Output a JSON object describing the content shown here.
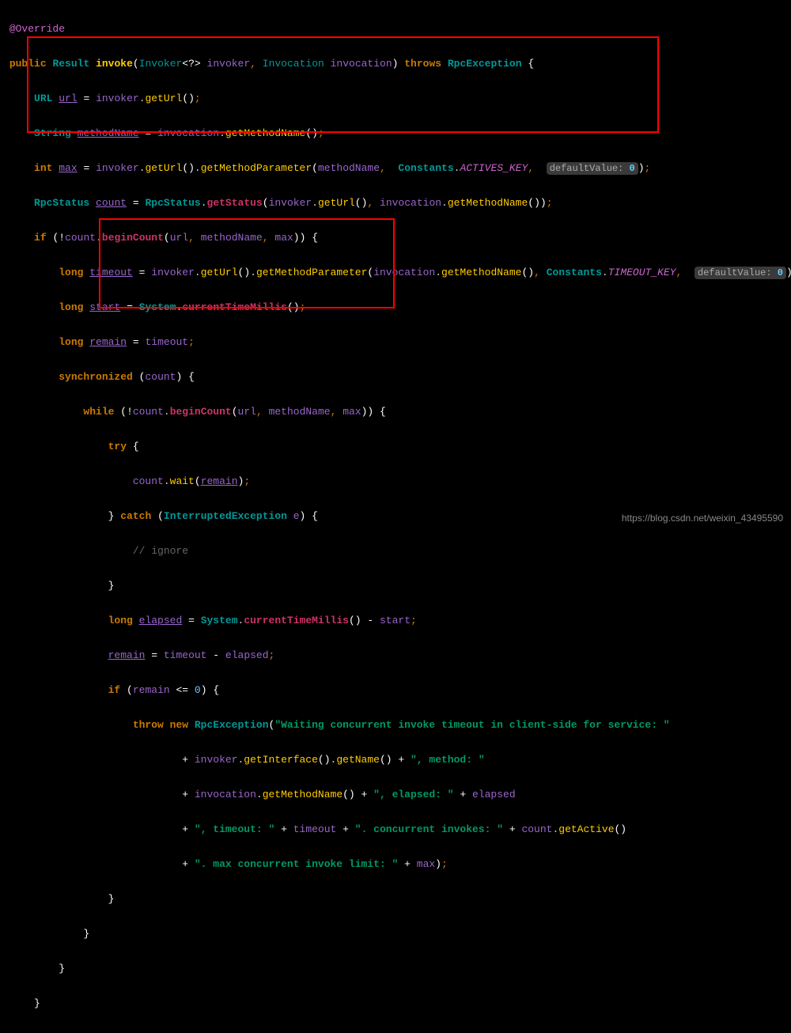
{
  "line01": {
    "ann": "@Override"
  },
  "line02": {
    "kw1": "public",
    "type": "Result",
    "mname": "invoke",
    "pt1": "Invoker",
    "q": "?",
    "pn1": "invoker",
    "pt2": "Invocation",
    "pn2": "invocation",
    "throws": "throws",
    "exc": "RpcException"
  },
  "line03": {
    "type": "URL",
    "var": "url",
    "op": "=",
    "r": "invoker",
    "dot": ".",
    "m": "getUrl"
  },
  "line04": {
    "type": "String",
    "var": "methodName",
    "op": "=",
    "r": "invocation",
    "m": "getMethodName"
  },
  "line05": {
    "type": "int",
    "var": "max",
    "op": "=",
    "r": "invoker",
    "m1": "getUrl",
    "m2": "getMethodParameter",
    "a1": "methodName",
    "cls": "Constants",
    "fld": "ACTIVES_KEY",
    "hint": "defaultValue:",
    "hv": "0"
  },
  "line06": {
    "type": "RpcStatus",
    "var": "count",
    "op": "=",
    "cls": "RpcStatus",
    "m": "getStatus",
    "r": "invoker",
    "m1": "getUrl",
    "r2": "invocation",
    "m2": "getMethodName"
  },
  "line07": {
    "kw": "if",
    "r": "count",
    "m": "beginCount",
    "a1": "url",
    "a2": "methodName",
    "a3": "max"
  },
  "line08": {
    "type": "long",
    "var": "timeout",
    "op": "=",
    "r": "invoker",
    "m1": "getUrl",
    "m2": "getMethodParameter",
    "r2": "invocation",
    "m3": "getMethodName",
    "cls": "Constants",
    "fld": "TIMEOUT_KEY",
    "hint": "defaultValue:",
    "hv": "0"
  },
  "line09": {
    "type": "long",
    "var": "start",
    "op": "=",
    "cls": "System",
    "m": "currentTimeMillis"
  },
  "line10": {
    "type": "long",
    "var": "remain",
    "op": "=",
    "r": "timeout"
  },
  "line11": {
    "kw": "synchronized",
    "a": "count"
  },
  "line12": {
    "kw": "while",
    "r": "count",
    "m": "beginCount",
    "a1": "url",
    "a2": "methodName",
    "a3": "max"
  },
  "line13": {
    "kw": "try"
  },
  "line14": {
    "r": "count",
    "m": "wait",
    "a": "remain"
  },
  "line15": {
    "kw": "catch",
    "type": "InterruptedException",
    "var": "e"
  },
  "line16": {
    "c": "// ignore"
  },
  "line18": {
    "type": "long",
    "var": "elapsed",
    "op": "=",
    "cls": "System",
    "m": "currentTimeMillis",
    "op2": "-",
    "r": "start"
  },
  "line19": {
    "var": "remain",
    "op": "=",
    "r1": "timeout",
    "op2": "-",
    "r2": "elapsed"
  },
  "line20": {
    "kw": "if",
    "var": "remain",
    "op": "<=",
    "n": "0"
  },
  "line21": {
    "kw1": "throw",
    "kw2": "new",
    "type": "RpcException",
    "s": "\"Waiting concurrent invoke timeout in client-side for service: \""
  },
  "line22": {
    "op": "+",
    "r": "invoker",
    "m1": "getInterface",
    "m2": "getName",
    "op2": "+",
    "s": "\", method: \""
  },
  "line23": {
    "op": "+",
    "r": "invocation",
    "m": "getMethodName",
    "op2": "+",
    "s": "\", elapsed: \"",
    "op3": "+",
    "r2": "elapsed"
  },
  "line24": {
    "op": "+",
    "s1": "\", timeout: \"",
    "op2": "+",
    "r1": "timeout",
    "op3": "+",
    "s2": "\". concurrent invokes: \"",
    "op4": "+",
    "r2": "count",
    "m": "getActive"
  },
  "line25": {
    "op": "+",
    "s": "\". max concurrent invoke limit: \"",
    "op2": "+",
    "r": "max"
  },
  "watermark": "https://blog.csdn.net/weixin_43495590"
}
